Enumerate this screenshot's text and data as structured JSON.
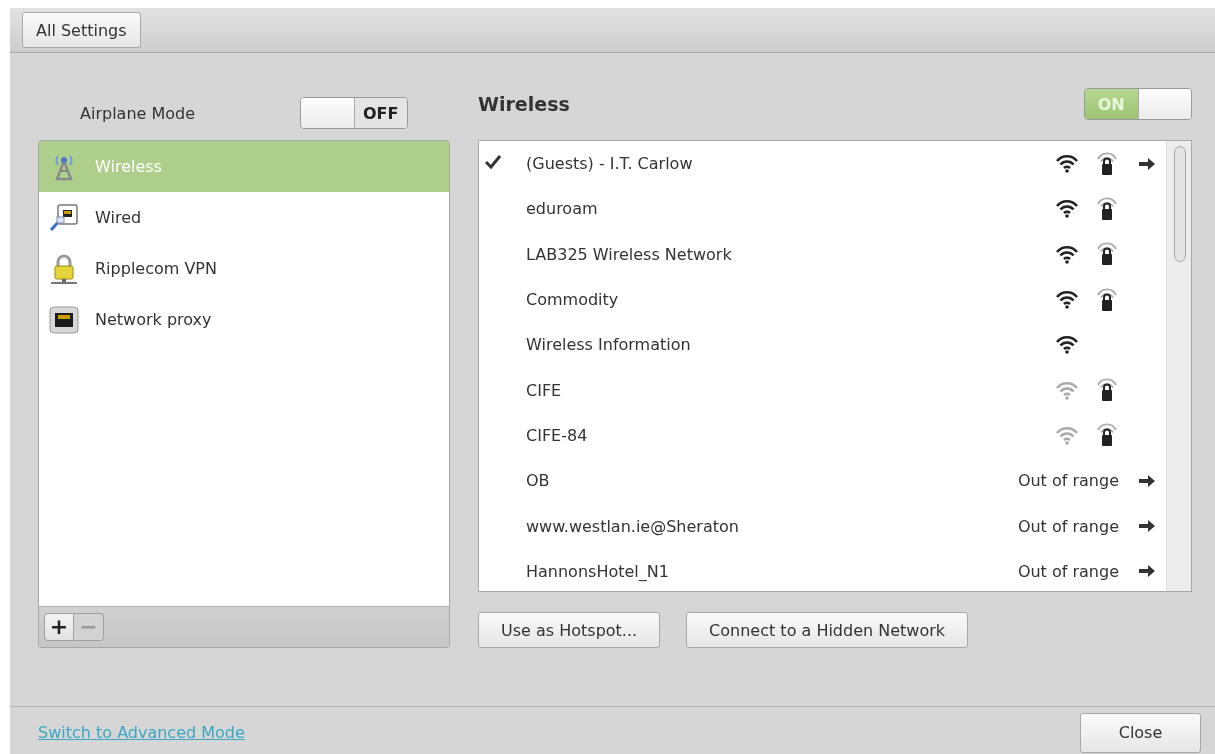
{
  "top_bar": {
    "button": "All Settings"
  },
  "airplane_mode": {
    "label": "Airplane Mode",
    "on": false,
    "state_text": "OFF"
  },
  "devices": [
    {
      "label": "Wireless",
      "kind": "wireless",
      "selected": true
    },
    {
      "label": "Wired",
      "kind": "wired",
      "selected": false
    },
    {
      "label": "Ripplecom VPN",
      "kind": "vpn",
      "selected": false
    },
    {
      "label": "Network proxy",
      "kind": "proxy",
      "selected": false
    }
  ],
  "device_toolbar": {
    "add": "+",
    "remove": "−",
    "remove_disabled": true
  },
  "wireless": {
    "title": "Wireless",
    "on": true,
    "state_text": "ON",
    "networks": [
      {
        "name": "(Guests) - I.T. Carlow",
        "connected": true,
        "signal_weak": false,
        "secured": true,
        "details": true
      },
      {
        "name": "eduroam",
        "connected": false,
        "signal_weak": false,
        "secured": true,
        "details": false
      },
      {
        "name": "LAB325 Wireless Network",
        "connected": false,
        "signal_weak": false,
        "secured": true,
        "details": false
      },
      {
        "name": "Commodity",
        "connected": false,
        "signal_weak": false,
        "secured": true,
        "details": false
      },
      {
        "name": "Wireless Information",
        "connected": false,
        "signal_weak": false,
        "secured": false,
        "details": false
      },
      {
        "name": "CIFE",
        "connected": false,
        "signal_weak": true,
        "secured": true,
        "details": false
      },
      {
        "name": "CIFE-84",
        "connected": false,
        "signal_weak": true,
        "secured": true,
        "details": false
      },
      {
        "name": "OB",
        "connected": false,
        "status": "Out of range",
        "details": true
      },
      {
        "name": "www.westlan.ie@Sheraton",
        "connected": false,
        "status": "Out of range",
        "details": true
      },
      {
        "name": "HannonsHotel_N1",
        "connected": false,
        "status": "Out of range",
        "details": true
      }
    ],
    "buttons": [
      "Use as Hotspot...",
      "Connect to a Hidden Network"
    ]
  },
  "footer": {
    "link": "Switch to Advanced Mode",
    "close": "Close"
  }
}
